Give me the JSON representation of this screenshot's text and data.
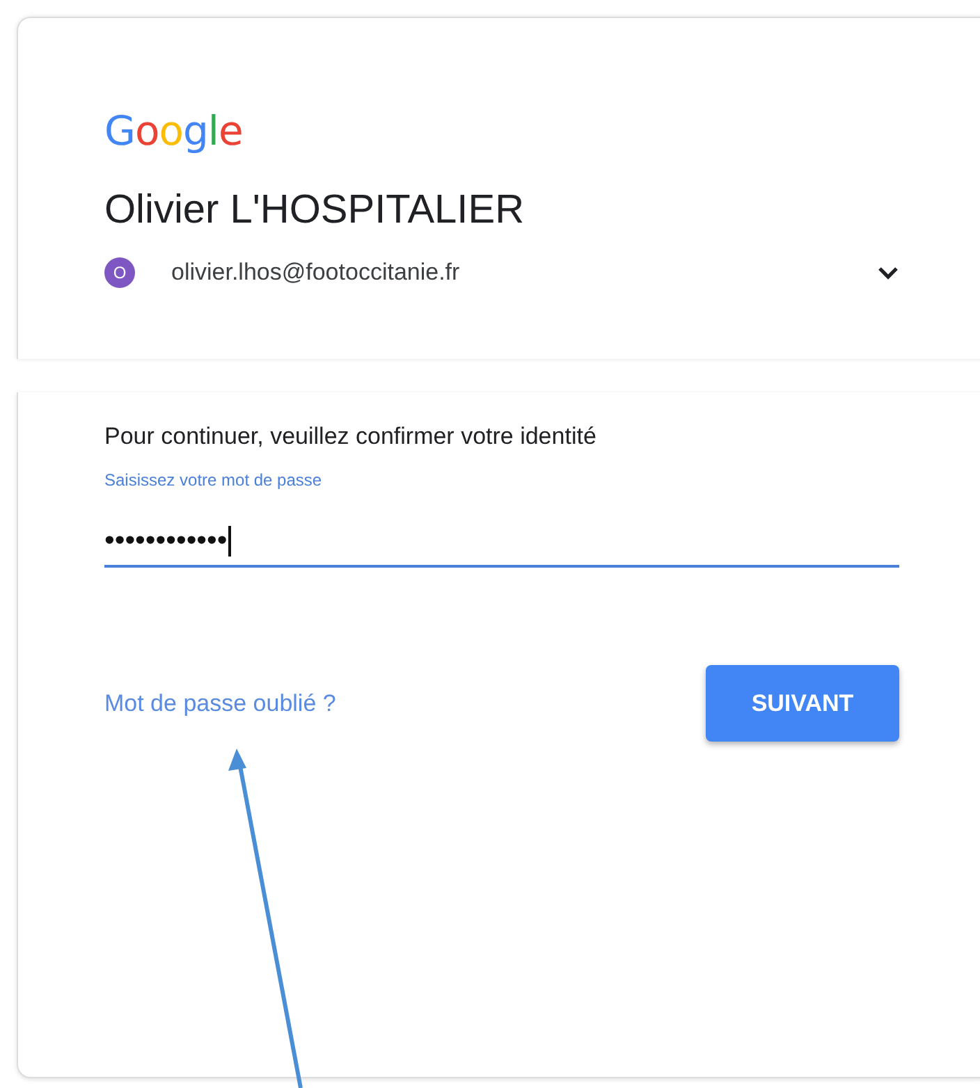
{
  "logo": "Google",
  "account": {
    "name": "Olivier L'HOSPITALIER",
    "avatar_initial": "O",
    "email": "olivier.lhos@footoccitanie.fr"
  },
  "prompt": "Pour continuer, veuillez confirmer votre identité",
  "password_field": {
    "label": "Saisissez votre mot de passe",
    "value": "••••••••••••",
    "focused": true
  },
  "forgot_link": "Mot de passe oublié ?",
  "next_button": "SUIVANT",
  "annotation": {
    "kind": "arrow"
  }
}
